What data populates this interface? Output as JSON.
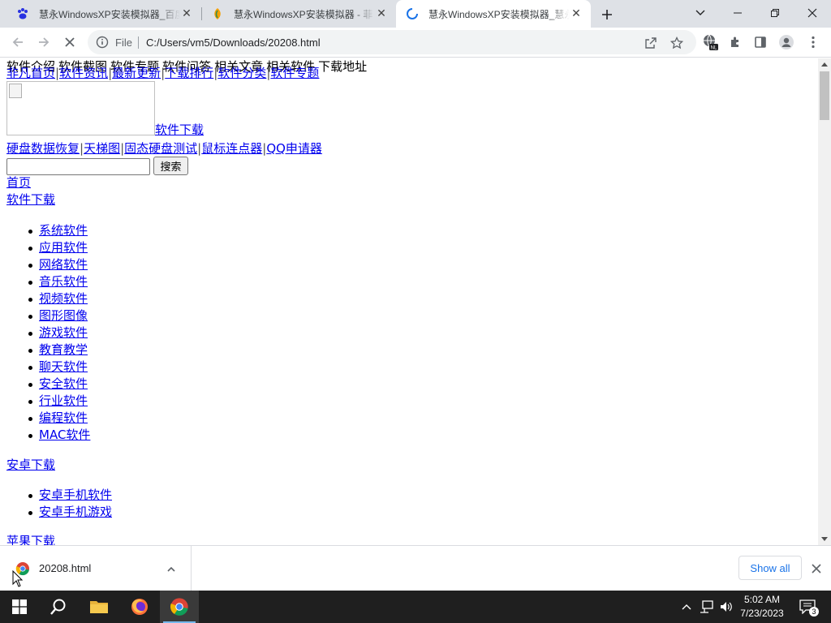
{
  "browser": {
    "tabs": [
      {
        "title": "慧永WindowsXP安装模拟器_百度",
        "active": false
      },
      {
        "title": "慧永WindowsXP安装模拟器 - 菲",
        "active": false
      },
      {
        "title": "慧永WindowsXP安装模拟器_慧永",
        "active": true
      }
    ],
    "address": {
      "scheme": "File",
      "url": "C:/Users/vm5/Downloads/20208.html"
    }
  },
  "page": {
    "top_nav": [
      "软件介绍",
      "软件截图",
      "软件专题",
      "软件问答",
      "相关文章",
      "相关软件",
      "下载地址"
    ],
    "site_nav": [
      "非凡首页",
      "软件资讯",
      "最新更新",
      "下载排行",
      "软件分类",
      "软件专题"
    ],
    "logo_link": "软件下载",
    "hot_links": [
      "硬盘数据恢复",
      "天梯图",
      "固态硬盘测试",
      "鼠标连点器",
      "QQ申请器"
    ],
    "search": {
      "value": "",
      "button": "搜索"
    },
    "home": "首页",
    "sections": [
      {
        "title": "软件下载",
        "items": [
          "系统软件",
          "应用软件",
          "网络软件",
          "音乐软件",
          "视频软件",
          "图形图像",
          "游戏软件",
          "教育教学",
          "聊天软件",
          "安全软件",
          "行业软件",
          "编程软件",
          "MAC软件"
        ]
      },
      {
        "title": "安卓下载",
        "items": [
          "安卓手机软件",
          "安卓手机游戏"
        ]
      },
      {
        "title": "苹果下载",
        "items": []
      }
    ]
  },
  "download_bar": {
    "file_name": "20208.html",
    "show_all": "Show all"
  },
  "taskbar": {
    "time": "5:02 AM",
    "date": "7/23/2023",
    "notification_count": "3"
  }
}
